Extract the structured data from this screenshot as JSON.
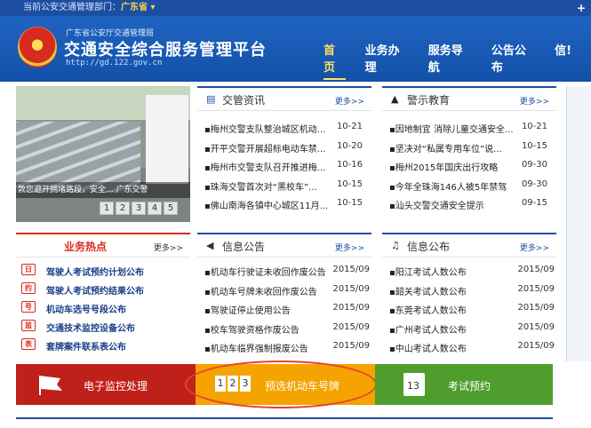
{
  "topbar": {
    "prefix": "当前公安交通管理部门：",
    "province": "广东省 ▾",
    "plus": "+"
  },
  "header": {
    "org": "广东省公安厅交通管理局",
    "title": "交通安全综合服务管理平台",
    "url": "http://gd.122.gov.cn"
  },
  "nav": [
    "首页",
    "业务办理",
    "服务导航",
    "公告公布",
    "信!"
  ],
  "slider": {
    "caption": "敦您避开拥堵路段，安全...   广东交警",
    "pages": [
      "1",
      "2",
      "3",
      "4",
      "5"
    ]
  },
  "news": {
    "title": "交管资讯",
    "icon": "newspaper-icon",
    "more": "更多>>",
    "items": [
      {
        "text": "梅州交警支队整治城区机动...",
        "date": "10-21"
      },
      {
        "text": "开平交警开展超标电动车禁...",
        "date": "10-20"
      },
      {
        "text": "梅州市交警支队召开推进梅...",
        "date": "10-16"
      },
      {
        "text": "珠海交警首次对“黑校车”...",
        "date": "10-15"
      },
      {
        "text": "佛山南海各镇中心城区11月...",
        "date": "10-15"
      }
    ]
  },
  "warn": {
    "title": "警示教育",
    "icon": "warning-icon",
    "more": "更多>>",
    "items": [
      {
        "text": "因地制宜 消除儿童交通安全...",
        "date": "10-21"
      },
      {
        "text": "坚决对“私属专用车位”说...",
        "date": "10-15"
      },
      {
        "text": "梅州2015年国庆出行攻略",
        "date": "09-30"
      },
      {
        "text": "今年全珠海146人被5年禁驾",
        "date": "09-30"
      },
      {
        "text": "汕头交警交通安全提示",
        "date": "09-15"
      }
    ]
  },
  "hot": {
    "title": "业务热点",
    "more": "更多>>",
    "items": [
      {
        "icon": "calendar-icon",
        "glyph": "日",
        "text": "驾驶人考试预约计划公布"
      },
      {
        "icon": "calendar-check-icon",
        "glyph": "约",
        "text": "驾驶人考试预约结果公布"
      },
      {
        "icon": "license-plate-icon",
        "glyph": "号",
        "text": "机动车选号号段公布"
      },
      {
        "icon": "camera-icon",
        "glyph": "监",
        "text": "交通技术监控设备公布"
      },
      {
        "icon": "table-icon",
        "glyph": "表",
        "text": "套牌案件联系表公布"
      }
    ]
  },
  "notice": {
    "title": "信息公告",
    "icon": "megaphone-icon",
    "more": "更多>>",
    "items": [
      {
        "text": "机动车行驶证未收回作废公告",
        "date": "2015/09"
      },
      {
        "text": "机动车号牌未收回作废公告",
        "date": "2015/09"
      },
      {
        "text": "驾驶证停止使用公告",
        "date": "2015/09"
      },
      {
        "text": "校车驾驶资格作废公告",
        "date": "2015/09"
      },
      {
        "text": "机动车临界强制报废公告",
        "date": "2015/09"
      }
    ]
  },
  "publish": {
    "title": "信息公布",
    "icon": "bell-icon",
    "more": "更多>>",
    "items": [
      {
        "text": "阳江考试人数公布",
        "date": "2015/09"
      },
      {
        "text": "韶关考试人数公布",
        "date": "2015/09"
      },
      {
        "text": "东莞考试人数公布",
        "date": "2015/09"
      },
      {
        "text": "广州考试人数公布",
        "date": "2015/09"
      },
      {
        "text": "中山考试人数公布",
        "date": "2015/09"
      }
    ]
  },
  "banners": [
    {
      "label": "电子监控处理",
      "icon": "flag-icon",
      "color": "#c0201a"
    },
    {
      "label": "预选机动车号牌",
      "icon": "number-plate-icon",
      "color": "#f4a300",
      "digits": [
        "1",
        "2",
        "3"
      ]
    },
    {
      "label": "考试预约",
      "icon": "calendar-13-icon",
      "color": "#4f9d2d",
      "day": "13"
    }
  ]
}
